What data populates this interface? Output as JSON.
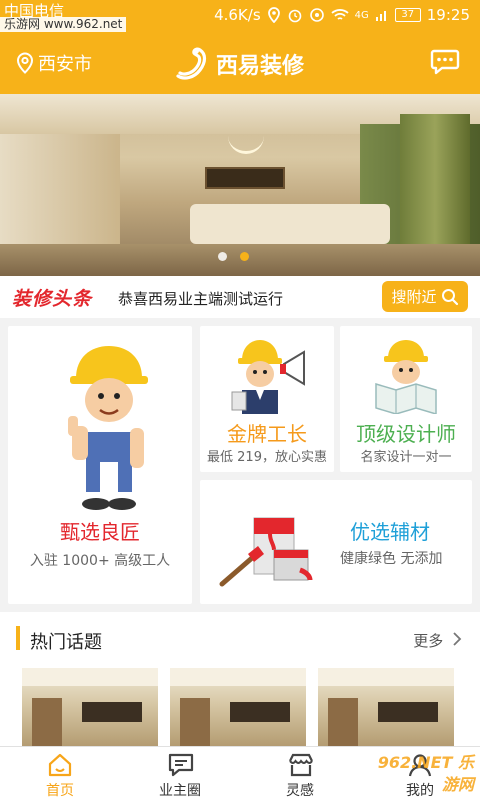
{
  "status_bar": {
    "carrier": "中国电信",
    "watermark": "乐游网 www.962.net",
    "speed": "4.6K/s",
    "signal": "4G",
    "battery": "37",
    "time": "19:25"
  },
  "header": {
    "city": "西安市",
    "brand": "西易装修",
    "location_icon": "location-pin-icon",
    "message_icon": "chat-bubble-icon"
  },
  "banner": {
    "slide_count": 2,
    "active_index": 1
  },
  "news": {
    "tag": "装修头条",
    "headline": "恭喜西易业主端测试运行",
    "nearby_label": "搜附近"
  },
  "cards": {
    "craftsman": {
      "title": "甄选良匠",
      "subtitle": "入驻 1000+ 高级工人"
    },
    "foreman": {
      "title": "金牌工长",
      "subtitle": "最低 219，放心实惠"
    },
    "designer": {
      "title": "顶级设计师",
      "subtitle": "名家设计一对一"
    },
    "materials": {
      "title": "优选辅材",
      "subtitle": "健康绿色 无添加"
    }
  },
  "hot_topics": {
    "title": "热门话题",
    "more": "更多"
  },
  "tabs": [
    {
      "label": "首页",
      "icon": "home-icon"
    },
    {
      "label": "业主圈",
      "icon": "chat-icon"
    },
    {
      "label": "灵感",
      "icon": "store-icon"
    },
    {
      "label": "我的",
      "icon": "user-icon"
    }
  ],
  "watermark_bottom": "962.NET 乐游网",
  "colors": {
    "primary": "#f7b219",
    "accent_red": "#e3272d",
    "accent_green": "#4caf50",
    "accent_blue": "#1fa0d8",
    "accent_orange": "#f59a1b"
  }
}
